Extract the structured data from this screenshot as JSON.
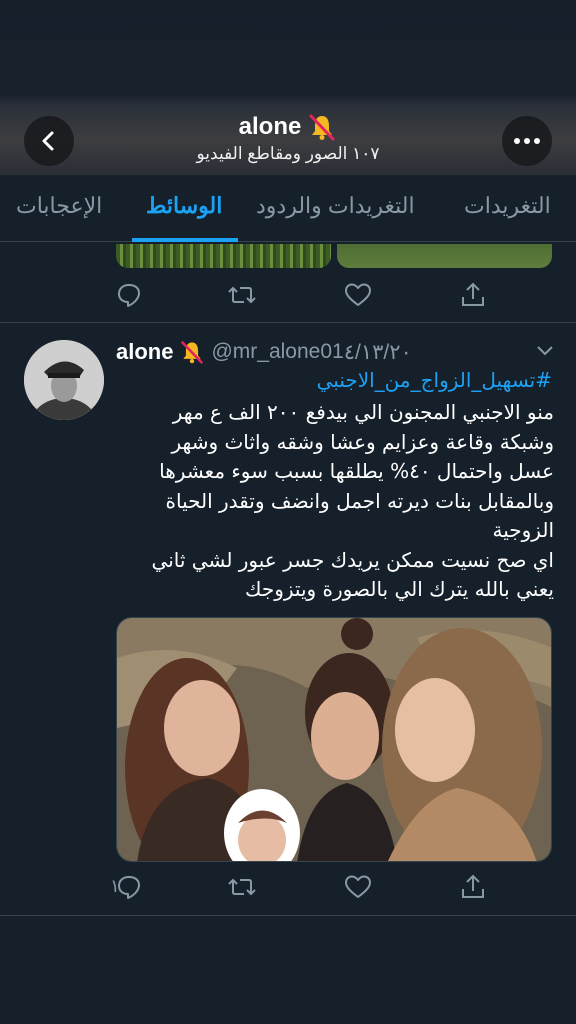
{
  "header": {
    "name": "alone",
    "subtitle": "١٠٧ الصور ومقاطع الفيديو",
    "back_icon": "chevron-left-icon",
    "more_icon": "more-horizontal-icon",
    "badge_icon": "muted-bell-icon"
  },
  "tabs": [
    {
      "label": "التغريدات",
      "active": false
    },
    {
      "label": "التغريدات والردود",
      "active": false
    },
    {
      "label": "الوسائط",
      "active": true
    },
    {
      "label": "الإعجابات",
      "active": false
    }
  ],
  "tweet": {
    "name": "alone",
    "handle": "@mr_alone01",
    "date": "٤/١٣/٢٠",
    "hashtag": "#تسهيل_الزواج_من_الاجنبي",
    "lines": [
      "منو الاجنبي المجنون الي بيدفع ٢٠٠ الف ع مهر",
      "وشبكة  وقاعة وعزايم وعشا وشقه واثاث وشهر",
      "عسل واحتمال ٤٠% يطلقها بسبب سوء معشرها",
      "وبالمقابل بنات ديرته اجمل وانضف وتقدر الحياة",
      "الزوجية",
      "اي صح نسيت ممكن يريدك جسر عبور لشي ثاني",
      "يعني بالله يترك الي بالصورة ويتزوجك"
    ],
    "reply_count": "١"
  },
  "colors": {
    "accent": "#1da1f2",
    "background": "#15202b",
    "muted": "#8899a6",
    "divider": "#38444d"
  }
}
